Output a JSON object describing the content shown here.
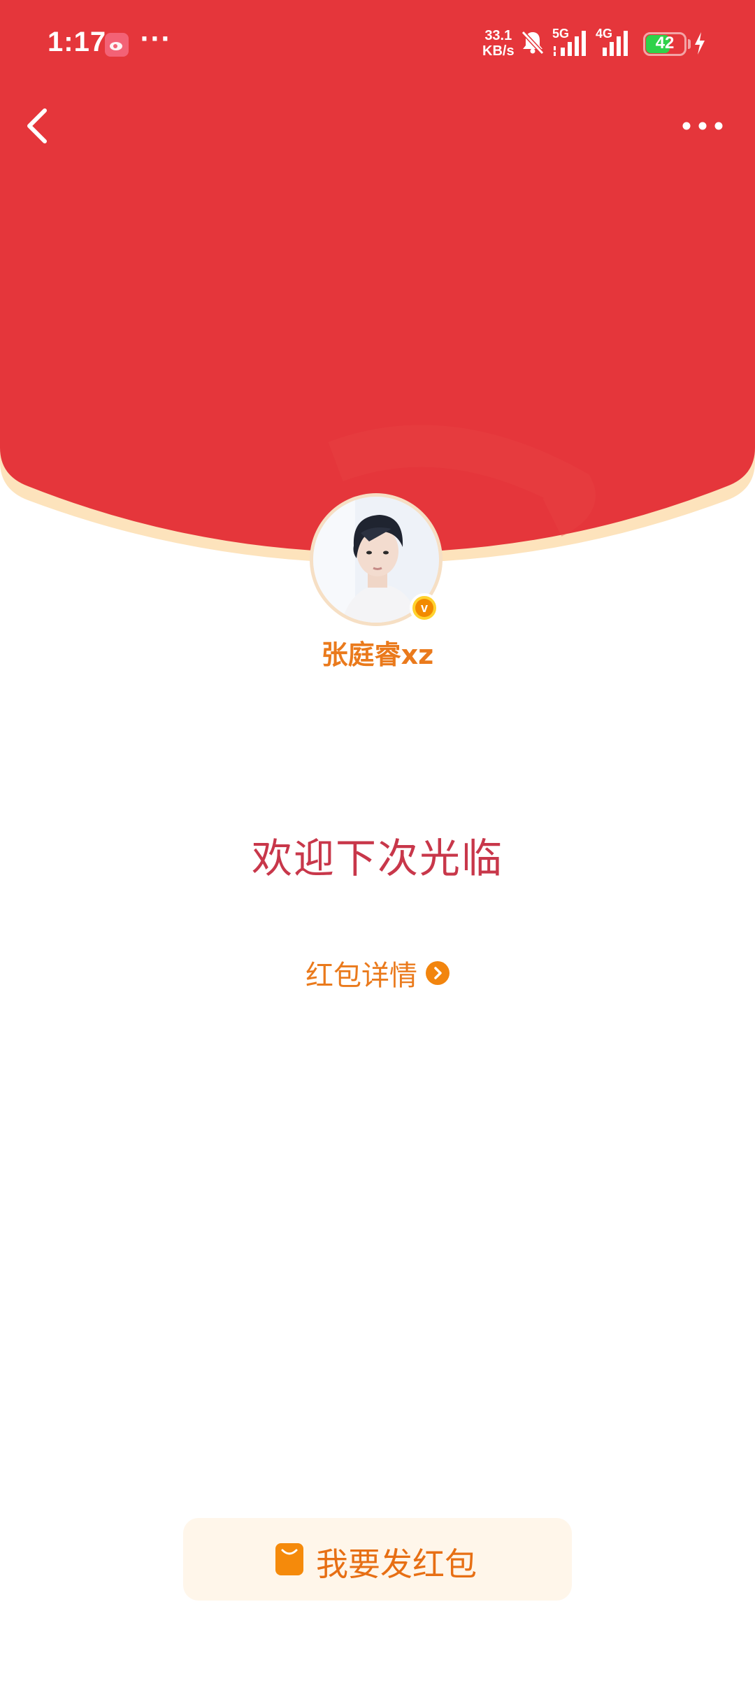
{
  "status_bar": {
    "time": "1:17",
    "dots": "···",
    "net_speed_value": "33.1",
    "net_speed_unit": "KB/s",
    "signal_1": "5G",
    "signal_2": "4G",
    "battery": "42"
  },
  "profile": {
    "username": "张庭睿xz"
  },
  "content": {
    "message": "欢迎下次光临",
    "details_label": "红包详情"
  },
  "footer": {
    "send_label": "我要发红包"
  },
  "colors": {
    "header_red": "#e5363b",
    "accent_orange": "#ea7a1c",
    "message_red": "#c8374a"
  }
}
